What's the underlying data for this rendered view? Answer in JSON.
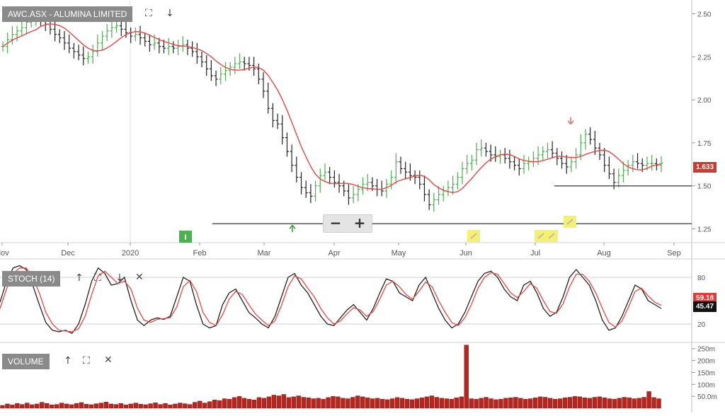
{
  "chart_data": [
    {
      "type": "line",
      "title": "AWC.ASX - ALUMINA LIMITED",
      "x_tick_labels": [
        "Nov",
        "Dec",
        "2020",
        "Feb",
        "Mar",
        "Apr",
        "May",
        "Jun",
        "Jul",
        "Aug",
        "Sep"
      ],
      "y_ticks": [
        1.25,
        1.5,
        1.75,
        2.0,
        2.25,
        2.5
      ],
      "ylim": [
        1.17,
        2.58
      ],
      "current_price": "1.633",
      "support_lines": [
        1.28,
        1.5
      ],
      "series": [
        {
          "type": "ohlc",
          "closes": [
            2.31,
            2.35,
            2.38,
            2.4,
            2.42,
            2.45,
            2.47,
            2.48,
            2.46,
            2.44,
            2.41,
            2.38,
            2.36,
            2.33,
            2.3,
            2.28,
            2.26,
            2.24,
            2.25,
            2.28,
            2.33,
            2.37,
            2.4,
            2.42,
            2.43,
            2.41,
            2.39,
            2.37,
            2.38,
            2.36,
            2.34,
            2.32,
            2.33,
            2.31,
            2.3,
            2.31,
            2.3,
            2.31,
            2.32,
            2.3,
            2.28,
            2.25,
            2.22,
            2.18,
            2.14,
            2.12,
            2.15,
            2.17,
            2.19,
            2.21,
            2.22,
            2.21,
            2.2,
            2.18,
            2.12,
            2.05,
            1.95,
            1.88,
            1.86,
            1.78,
            1.7,
            1.62,
            1.55,
            1.49,
            1.46,
            1.44,
            1.5,
            1.56,
            1.58,
            1.55,
            1.52,
            1.5,
            1.47,
            1.43,
            1.45,
            1.48,
            1.51,
            1.52,
            1.5,
            1.48,
            1.47,
            1.51,
            1.55,
            1.64,
            1.6,
            1.58,
            1.56,
            1.55,
            1.51,
            1.45,
            1.39,
            1.42,
            1.45,
            1.47,
            1.49,
            1.51,
            1.55,
            1.6,
            1.63,
            1.65,
            1.71,
            1.72,
            1.7,
            1.68,
            1.67,
            1.68,
            1.66,
            1.64,
            1.62,
            1.6,
            1.63,
            1.64,
            1.66,
            1.68,
            1.7,
            1.71,
            1.69,
            1.66,
            1.63,
            1.61,
            1.64,
            1.68,
            1.75,
            1.8,
            1.77,
            1.72,
            1.68,
            1.62,
            1.57,
            1.52,
            1.56,
            1.59,
            1.62,
            1.64,
            1.63,
            1.62,
            1.63,
            1.63,
            1.62,
            1.633
          ]
        },
        {
          "type": "moving-average",
          "color": "#ef4444"
        }
      ],
      "annotations": {
        "buy_arrow": {
          "date": "Mar",
          "price": 1.28
        },
        "sell_arrow": {
          "date": "Jul",
          "price": 1.85
        },
        "marker_i": {
          "label": "I",
          "date": "Feb"
        },
        "note_markers": [
          {
            "date": "Jun"
          },
          {
            "date": "Jul"
          },
          {
            "date": "Jul"
          },
          {
            "date": "Jul"
          }
        ]
      }
    },
    {
      "type": "line",
      "title": "STOCH (14)",
      "y_ticks": [
        20,
        80
      ],
      "ylim": [
        0,
        100
      ],
      "values_readout": [
        "59.18",
        "45.47"
      ],
      "series": [
        {
          "name": "%K",
          "color": "#222222",
          "values": [
            48,
            75,
            92,
            95,
            90,
            70,
            45,
            22,
            12,
            10,
            12,
            8,
            20,
            45,
            75,
            92,
            85,
            70,
            72,
            80,
            50,
            25,
            18,
            25,
            28,
            26,
            30,
            55,
            80,
            75,
            45,
            20,
            15,
            18,
            45,
            60,
            65,
            50,
            35,
            28,
            20,
            15,
            30,
            55,
            80,
            85,
            70,
            60,
            45,
            30,
            20,
            18,
            28,
            38,
            45,
            35,
            25,
            40,
            60,
            78,
            75,
            60,
            55,
            50,
            70,
            80,
            60,
            40,
            25,
            15,
            20,
            35,
            55,
            75,
            85,
            88,
            80,
            65,
            55,
            50,
            70,
            75,
            60,
            40,
            30,
            35,
            55,
            80,
            90,
            80,
            70,
            50,
            25,
            12,
            15,
            30,
            50,
            70,
            65,
            50,
            45,
            40
          ]
        },
        {
          "name": "%D",
          "color": "#ef4444",
          "values": [
            40,
            65,
            85,
            92,
            92,
            80,
            60,
            35,
            20,
            12,
            11,
            10,
            14,
            30,
            58,
            82,
            88,
            80,
            72,
            75,
            65,
            40,
            25,
            22,
            26,
            27,
            28,
            42,
            68,
            76,
            62,
            35,
            22,
            18,
            32,
            52,
            62,
            58,
            45,
            33,
            25,
            18,
            24,
            44,
            68,
            82,
            78,
            66,
            55,
            40,
            28,
            20,
            24,
            33,
            41,
            38,
            30,
            36,
            52,
            70,
            75,
            68,
            58,
            52,
            62,
            74,
            68,
            50,
            35,
            22,
            18,
            28,
            45,
            66,
            80,
            86,
            84,
            72,
            60,
            54,
            62,
            72,
            66,
            50,
            36,
            34,
            46,
            68,
            84,
            84,
            75,
            60,
            40,
            22,
            16,
            24,
            42,
            62,
            66,
            56,
            48,
            44
          ]
        }
      ]
    },
    {
      "type": "bar",
      "title": "VOLUME",
      "y_tick_labels": [
        "250m",
        "200m",
        "150m",
        "100m",
        "50.0m"
      ],
      "y_ticks": [
        250,
        200,
        150,
        100,
        50
      ],
      "ylim": [
        0,
        270
      ],
      "bar_color": "#b5261e",
      "values": [
        12,
        18,
        14,
        20,
        16,
        22,
        15,
        18,
        25,
        20,
        14,
        16,
        22,
        18,
        15,
        20,
        24,
        17,
        15,
        19,
        22,
        26,
        18,
        16,
        20,
        14,
        18,
        22,
        17,
        15,
        19,
        23,
        16,
        20,
        14,
        18,
        22,
        19,
        16,
        25,
        30,
        22,
        28,
        35,
        32,
        40,
        38,
        45,
        50,
        42,
        38,
        35,
        45,
        42,
        48,
        55,
        52,
        58,
        45,
        48,
        52,
        46,
        44,
        40,
        42,
        38,
        45,
        50,
        48,
        42,
        40,
        46,
        52,
        48,
        44,
        40,
        42,
        38,
        36,
        40,
        45,
        42,
        38,
        36,
        40,
        44,
        48,
        52,
        46,
        42,
        40,
        38,
        44,
        48,
        265,
        40,
        38,
        42,
        46,
        40,
        36,
        38,
        42,
        44,
        46,
        42,
        38,
        40,
        44,
        48,
        46,
        42,
        38,
        40,
        44,
        46,
        50,
        48,
        44,
        42,
        46,
        48,
        44,
        40,
        38,
        42,
        46,
        44,
        40,
        42,
        46,
        70,
        45,
        40
      ]
    }
  ],
  "ui": {
    "price_panel_label": "AWC.ASX - ALUMINA LIMITED",
    "stoch_panel_label": "STOCH (14)",
    "volume_panel_label": "VOLUME",
    "zoom_out_label": "−",
    "zoom_in_label": "+",
    "colors": {
      "ma_line": "#ef4444",
      "stoch_k": "#222222",
      "stoch_d": "#ef4444",
      "volume": "#b5261e",
      "price_up": "#4caf50",
      "price_down": "#222222",
      "price_tag": "#cc3b2e",
      "marker_i": "#4caf50",
      "note_marker": "#f5f06e"
    },
    "icons": {
      "fullscreen": "fullscreen-icon",
      "download": "arrow-down-icon",
      "move_up": "arrow-up-icon",
      "move_down": "arrow-down-icon",
      "close": "close-icon"
    }
  }
}
